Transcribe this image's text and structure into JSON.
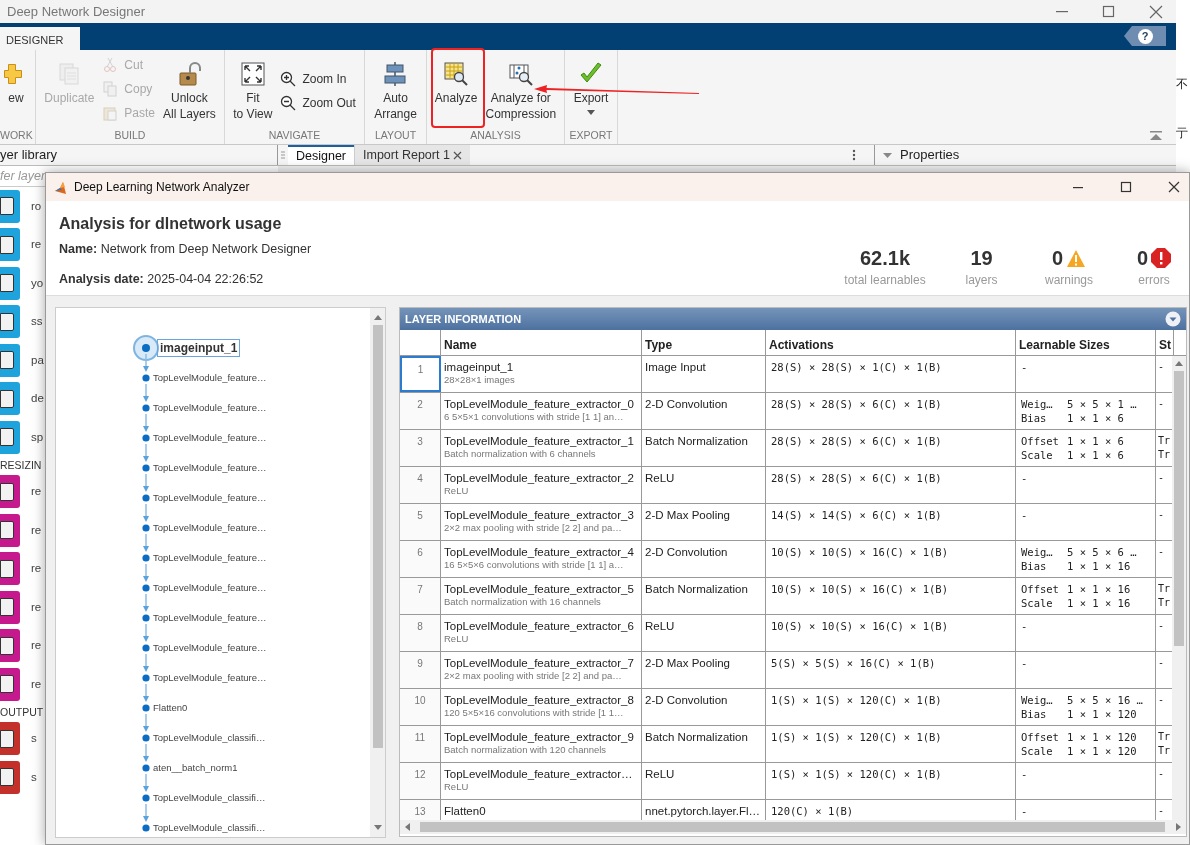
{
  "app": {
    "title": "Deep Network Designer"
  },
  "ribbon": {
    "tab": "DESIGNER",
    "help": "?",
    "groups": [
      {
        "label": "WORK",
        "buttons": [
          {
            "kind": "large",
            "lines": [
              "ew"
            ],
            "disabled": false,
            "dropdown": false
          }
        ]
      },
      {
        "label": "BUILD",
        "buttons": [
          {
            "kind": "large",
            "lines": [
              "Duplicate"
            ],
            "disabled": true,
            "dropdown": false
          },
          {
            "kind": "small",
            "lines": [
              "Cut"
            ],
            "disabled": true,
            "dropdown": false
          },
          {
            "kind": "small",
            "lines": [
              "Copy"
            ],
            "disabled": true,
            "dropdown": false
          },
          {
            "kind": "small",
            "lines": [
              "Paste"
            ],
            "disabled": true,
            "dropdown": false
          },
          {
            "kind": "large",
            "lines": [
              "Unlock",
              "All Layers"
            ],
            "disabled": false,
            "dropdown": false
          }
        ]
      },
      {
        "label": "NAVIGATE",
        "buttons": [
          {
            "kind": "large",
            "lines": [
              "Fit",
              "to View"
            ],
            "disabled": false,
            "dropdown": false
          },
          {
            "kind": "small",
            "lines": [
              "Zoom In"
            ],
            "disabled": false,
            "dropdown": false
          },
          {
            "kind": "small",
            "lines": [
              "Zoom Out"
            ],
            "disabled": false,
            "dropdown": false
          }
        ]
      },
      {
        "label": "LAYOUT",
        "buttons": [
          {
            "kind": "large",
            "lines": [
              "Auto",
              "Arrange"
            ],
            "disabled": false,
            "dropdown": false
          }
        ]
      },
      {
        "label": "ANALYSIS",
        "buttons": [
          {
            "kind": "large",
            "lines": [
              "Analyze"
            ],
            "disabled": false,
            "dropdown": false
          },
          {
            "kind": "large",
            "lines": [
              "Analyze for",
              "Compression"
            ],
            "disabled": false,
            "dropdown": false
          }
        ]
      },
      {
        "label": "EXPORT",
        "buttons": [
          {
            "kind": "large",
            "lines": [
              "Export"
            ],
            "disabled": false,
            "dropdown": true
          }
        ]
      }
    ]
  },
  "side_fragments": [
    "不",
    "亍"
  ],
  "panels": {
    "library_title": "yer library",
    "tabs": [
      {
        "label": "Designer",
        "selected": true,
        "closable": false
      },
      {
        "label": "Import Report 1",
        "selected": false,
        "closable": true
      }
    ],
    "properties_title": "Properties"
  },
  "layer_library": {
    "search_placeholder": "fer layer",
    "sections": [
      {
        "color": "#1ea3dd",
        "items": [
          "ro",
          "re",
          "yo",
          "ss",
          "pa",
          "de",
          "sp"
        ]
      },
      {
        "heading": "RESIZIN",
        "color": "#c5198d",
        "items": [
          "re",
          "re",
          "re",
          "re",
          "re",
          "re"
        ]
      },
      {
        "heading": "OUTPUT",
        "color": "#c4312b",
        "items": [
          "s",
          "s"
        ]
      }
    ]
  },
  "analyzer": {
    "title": "Deep Learning Network Analyzer",
    "heading": "Analysis for dlnetwork usage",
    "fields": [
      {
        "label": "Name:",
        "value": "Network from Deep Network Designer"
      },
      {
        "label": "Analysis date:",
        "value": "2025-04-04 22:26:52"
      }
    ],
    "stats": [
      {
        "value": "62.1k",
        "label": "total learnables",
        "kind": "plain"
      },
      {
        "value": "19",
        "label": "layers",
        "kind": "plain"
      },
      {
        "value": "0",
        "label": "warnings",
        "kind": "warning"
      },
      {
        "value": "0",
        "label": "errors",
        "kind": "error"
      }
    ],
    "graph": {
      "nodes": [
        {
          "label": "imageinput_1",
          "selected": true
        },
        {
          "label": "TopLevelModule_feature…",
          "selected": false
        },
        {
          "label": "TopLevelModule_feature…",
          "selected": false
        },
        {
          "label": "TopLevelModule_feature…",
          "selected": false
        },
        {
          "label": "TopLevelModule_feature…",
          "selected": false
        },
        {
          "label": "TopLevelModule_feature…",
          "selected": false
        },
        {
          "label": "TopLevelModule_feature…",
          "selected": false
        },
        {
          "label": "TopLevelModule_feature…",
          "selected": false
        },
        {
          "label": "TopLevelModule_feature…",
          "selected": false
        },
        {
          "label": "TopLevelModule_feature…",
          "selected": false
        },
        {
          "label": "TopLevelModule_feature…",
          "selected": false
        },
        {
          "label": "TopLevelModule_feature…",
          "selected": false
        },
        {
          "label": "Flatten0",
          "selected": false
        },
        {
          "label": "TopLevelModule_classifi…",
          "selected": false
        },
        {
          "label": "aten__batch_norm1",
          "selected": false
        },
        {
          "label": "TopLevelModule_classifi…",
          "selected": false
        },
        {
          "label": "TopLevelModule_classifi…",
          "selected": false
        }
      ]
    },
    "layer_table": {
      "title": "LAYER INFORMATION",
      "columns": [
        "Name",
        "Type",
        "Activations",
        "Learnable Sizes",
        "St"
      ],
      "rows": [
        {
          "index": "1",
          "name": "imageinput_1",
          "description": "28×28×1 images",
          "type": "Image Input",
          "activations": "28(S) × 28(S) × 1(C) × 1(B)",
          "learnables": [
            {
              "name": "-"
            }
          ],
          "states": [
            "-"
          ],
          "selected": true
        },
        {
          "index": "2",
          "name": "TopLevelModule_feature_extractor_0",
          "description": "6 5×5×1 convolutions with stride [1 1] an…",
          "type": "2-D Convolution",
          "activations": "28(S) × 28(S) × 6(C) × 1(B)",
          "learnables": [
            {
              "name": "Weig…",
              "size": "5 × 5 × 1 …"
            },
            {
              "name": "Bias",
              "size": "1 × 1 × 6"
            }
          ],
          "states": [
            "-"
          ],
          "selected": false
        },
        {
          "index": "3",
          "name": "TopLevelModule_feature_extractor_1",
          "description": "Batch normalization with 6 channels",
          "type": "Batch Normalization",
          "activations": "28(S) × 28(S) × 6(C) × 1(B)",
          "learnables": [
            {
              "name": "Offset",
              "size": "1 × 1 × 6"
            },
            {
              "name": "Scale",
              "size": "1 × 1 × 6"
            }
          ],
          "states": [
            "Tr",
            "Tr"
          ],
          "selected": false
        },
        {
          "index": "4",
          "name": "TopLevelModule_feature_extractor_2",
          "description": "ReLU",
          "type": "ReLU",
          "activations": "28(S) × 28(S) × 6(C) × 1(B)",
          "learnables": [
            {
              "name": "-"
            }
          ],
          "states": [
            "-"
          ],
          "selected": false
        },
        {
          "index": "5",
          "name": "TopLevelModule_feature_extractor_3",
          "description": "2×2 max pooling with stride [2 2] and pa…",
          "type": "2-D Max Pooling",
          "activations": "14(S) × 14(S) × 6(C) × 1(B)",
          "learnables": [
            {
              "name": "-"
            }
          ],
          "states": [
            "-"
          ],
          "selected": false
        },
        {
          "index": "6",
          "name": "TopLevelModule_feature_extractor_4",
          "description": "16 5×5×6 convolutions with stride [1 1] a…",
          "type": "2-D Convolution",
          "activations": "10(S) × 10(S) × 16(C) × 1(B)",
          "learnables": [
            {
              "name": "Weig…",
              "size": "5 × 5 × 6 …"
            },
            {
              "name": "Bias",
              "size": "1 × 1 × 16"
            }
          ],
          "states": [
            "-"
          ],
          "selected": false
        },
        {
          "index": "7",
          "name": "TopLevelModule_feature_extractor_5",
          "description": "Batch normalization with 16 channels",
          "type": "Batch Normalization",
          "activations": "10(S) × 10(S) × 16(C) × 1(B)",
          "learnables": [
            {
              "name": "Offset",
              "size": "1 × 1 × 16"
            },
            {
              "name": "Scale",
              "size": "1 × 1 × 16"
            }
          ],
          "states": [
            "Tr",
            "Tr"
          ],
          "selected": false
        },
        {
          "index": "8",
          "name": "TopLevelModule_feature_extractor_6",
          "description": "ReLU",
          "type": "ReLU",
          "activations": "10(S) × 10(S) × 16(C) × 1(B)",
          "learnables": [
            {
              "name": "-"
            }
          ],
          "states": [
            "-"
          ],
          "selected": false
        },
        {
          "index": "9",
          "name": "TopLevelModule_feature_extractor_7",
          "description": "2×2 max pooling with stride [2 2] and pa…",
          "type": "2-D Max Pooling",
          "activations": "5(S) × 5(S) × 16(C) × 1(B)",
          "learnables": [
            {
              "name": "-"
            }
          ],
          "states": [
            "-"
          ],
          "selected": false
        },
        {
          "index": "10",
          "name": "TopLevelModule_feature_extractor_8",
          "description": "120 5×5×16 convolutions with stride [1 1…",
          "type": "2-D Convolution",
          "activations": "1(S) × 1(S) × 120(C) × 1(B)",
          "learnables": [
            {
              "name": "Weig…",
              "size": "5 × 5 × 16 …"
            },
            {
              "name": "Bias",
              "size": "1 × 1 × 120"
            }
          ],
          "states": [
            "-"
          ],
          "selected": false
        },
        {
          "index": "11",
          "name": "TopLevelModule_feature_extractor_9",
          "description": "Batch normalization with 120 channels",
          "type": "Batch Normalization",
          "activations": "1(S) × 1(S) × 120(C) × 1(B)",
          "learnables": [
            {
              "name": "Offset",
              "size": "1 × 1 × 120"
            },
            {
              "name": "Scale",
              "size": "1 × 1 × 120"
            }
          ],
          "states": [
            "Tr",
            "Tr"
          ],
          "selected": false
        },
        {
          "index": "12",
          "name": "TopLevelModule_feature_extractor…",
          "description": "ReLU",
          "type": "ReLU",
          "activations": "1(S) × 1(S) × 120(C) × 1(B)",
          "learnables": [
            {
              "name": "-"
            }
          ],
          "states": [
            "-"
          ],
          "selected": false
        },
        {
          "index": "13",
          "name": "Flatten0",
          "type": "nnet.pytorch.layer.Fl…",
          "activations": "120(C) × 1(B)",
          "learnables": [
            {
              "name": "-"
            }
          ],
          "states": [
            "-"
          ],
          "selected": false
        }
      ]
    }
  }
}
